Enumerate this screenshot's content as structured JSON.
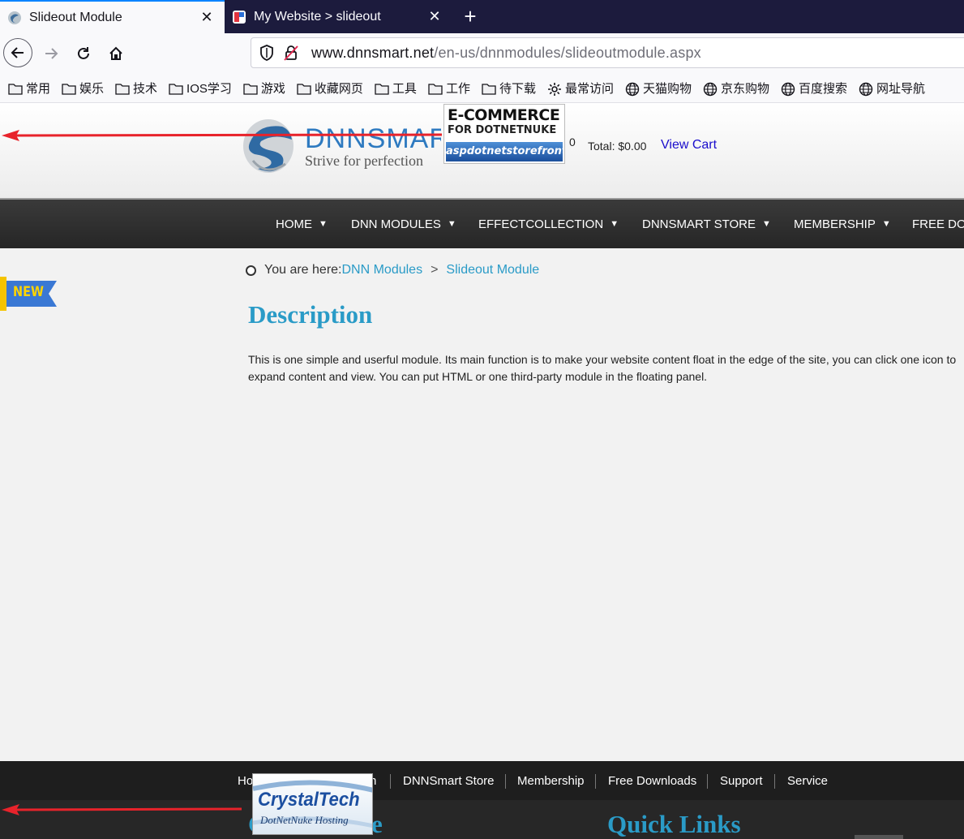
{
  "browser": {
    "tabs": [
      {
        "title": "Slideout Module",
        "active": true
      },
      {
        "title": "My Website > slideout",
        "active": false
      }
    ],
    "url": {
      "host": "www.dnnsmart.net",
      "path": "/en-us/dnnmodules/slideoutmodule.aspx"
    },
    "bookmarks": [
      {
        "label": "常用",
        "icon": "folder-icon"
      },
      {
        "label": "娱乐",
        "icon": "folder-icon"
      },
      {
        "label": "技术",
        "icon": "folder-icon"
      },
      {
        "label": "IOS学习",
        "icon": "folder-icon"
      },
      {
        "label": "游戏",
        "icon": "folder-icon"
      },
      {
        "label": "收藏网页",
        "icon": "folder-icon"
      },
      {
        "label": "工具",
        "icon": "folder-icon"
      },
      {
        "label": "工作",
        "icon": "folder-icon"
      },
      {
        "label": "待下载",
        "icon": "folder-icon"
      },
      {
        "label": "最常访问",
        "icon": "gear-icon"
      },
      {
        "label": "天猫购物",
        "icon": "globe-icon"
      },
      {
        "label": "京东购物",
        "icon": "globe-icon"
      },
      {
        "label": "百度搜索",
        "icon": "globe-icon"
      },
      {
        "label": "网址导航",
        "icon": "globe-icon"
      }
    ]
  },
  "site": {
    "logo": {
      "text": "DNNSMART",
      "tagline": "Strive for perfection"
    },
    "ad": {
      "line1": "E-COMMERCE",
      "line2": "FOR DOTNETNUKE",
      "line3": "aspdotnetstorefront"
    },
    "cart": {
      "count": "0",
      "total": "Total: $0.00",
      "view_cart": "View Cart"
    },
    "menu": [
      "HOME",
      "DNN MODULES",
      "EFFECTCOLLECTION",
      "DNNSMART STORE",
      "MEMBERSHIP",
      "FREE DOWNLOADS"
    ],
    "badge": "NEW",
    "breadcrumb": {
      "prefix": "You are here:",
      "items": [
        "DNN Modules",
        "Slideout Module"
      ],
      "separator": ">"
    },
    "description": {
      "title": "Description",
      "body": "This is one simple and userful module. Its main function is to make your website content float in the edge of the site, you can click one icon to expand content and view. You can put HTML or one third-party module in the floating panel."
    },
    "footer": {
      "links_left_partial": "Ho",
      "links_left_tail": "h",
      "links": [
        "DNNSmart Store",
        "Membership",
        "Free Downloads",
        "Support",
        "Service"
      ],
      "heading_left_first": "C",
      "heading_left_last": "e",
      "quick_links": "Quick Links",
      "crystal": {
        "name": "CrystalTech",
        "sub": "DotNetNuke Hosting"
      }
    }
  },
  "colors": {
    "accent": "#2a9bc7",
    "arrow": "#e8232b"
  }
}
